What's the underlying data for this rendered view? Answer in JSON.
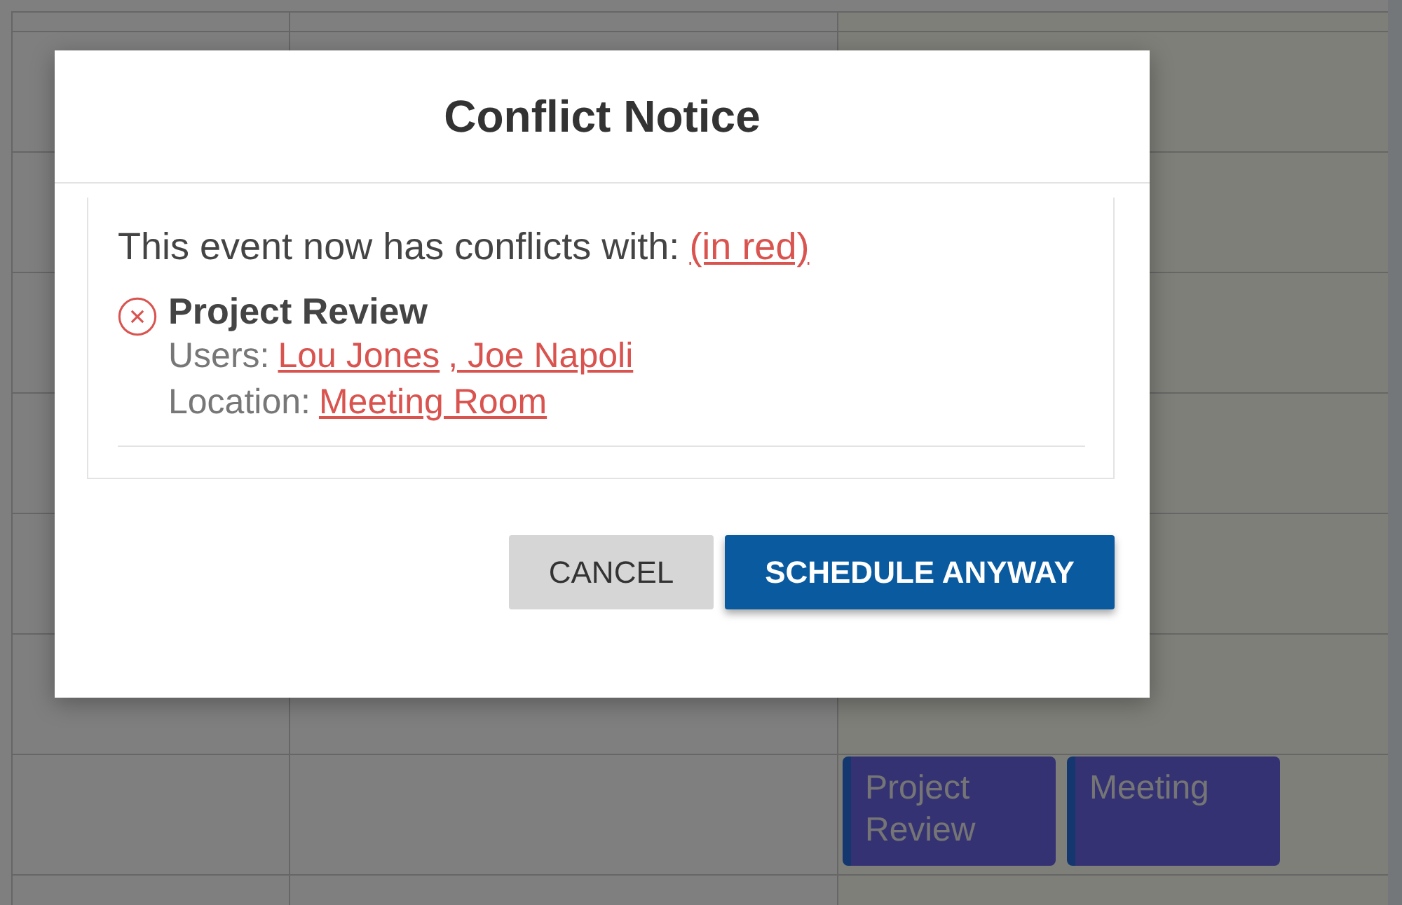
{
  "calendar": {
    "events": [
      {
        "title": "Project Review"
      },
      {
        "title": "Meeting"
      }
    ]
  },
  "dialog": {
    "title": "Conflict Notice",
    "message": "This event now has conflicts with:",
    "message_link": "(in red)",
    "conflicts": [
      {
        "title": "Project Review",
        "users_label": "Users:",
        "users": [
          "Lou Jones",
          ", Joe Napoli"
        ],
        "location_label": "Location:",
        "location": "Meeting Room"
      }
    ],
    "buttons": [
      {
        "label": "CANCEL",
        "kind": "secondary"
      },
      {
        "label": "SCHEDULE ANYWAY",
        "kind": "primary"
      }
    ]
  }
}
